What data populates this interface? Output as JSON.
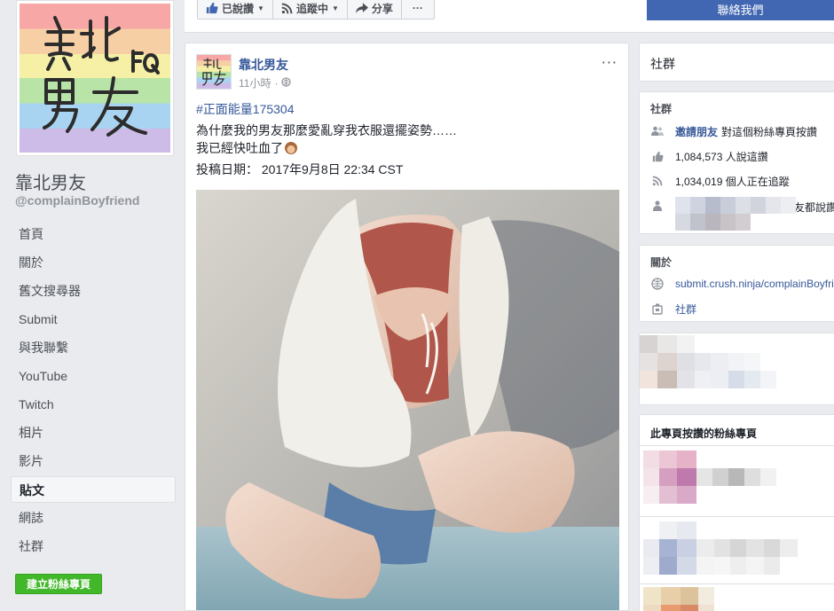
{
  "page": {
    "name": "靠北男友",
    "handle": "@complainBoyfriend",
    "create_page_label": "建立粉絲專頁"
  },
  "nav": [
    {
      "label": "首頁",
      "active": false
    },
    {
      "label": "關於",
      "active": false
    },
    {
      "label": "舊文搜尋器",
      "active": false
    },
    {
      "label": "Submit",
      "active": false
    },
    {
      "label": "與我聯繫",
      "active": false
    },
    {
      "label": "YouTube",
      "active": false
    },
    {
      "label": "Twitch",
      "active": false
    },
    {
      "label": "相片",
      "active": false
    },
    {
      "label": "影片",
      "active": false
    },
    {
      "label": "貼文",
      "active": true
    },
    {
      "label": "網誌",
      "active": false
    },
    {
      "label": "社群",
      "active": false
    }
  ],
  "topbar": {
    "liked_label": "已說讚",
    "following_label": "追蹤中",
    "share_label": "分享",
    "more_label": "···",
    "contact_label": "聯絡我們"
  },
  "post": {
    "author": "靠北男友",
    "time": "11小時",
    "separator": "·",
    "hashtag": "#正面能量175304",
    "line1": "為什麼我的男友那麼愛亂穿我衣服還擺姿勢……",
    "line2": "我已經快吐血了",
    "date_line": "投稿日期： 2017年9月8日 22:34 CST",
    "more_label": "···"
  },
  "right": {
    "community_header": "社群",
    "community": {
      "title": "社群",
      "invite_link": "邀請朋友",
      "invite_rest": "對這個粉絲專頁按讚",
      "likes": "1,084,573 人說這讚",
      "follows": "1,034,019 個人正在追蹤",
      "friends_suffix": "友都說讚"
    },
    "about": {
      "title": "關於",
      "url": "submit.crush.ninja/complainBoyfriend",
      "category": "社群"
    },
    "liked_pages_title": "此專頁按讚的粉絲專頁"
  },
  "icons": {
    "like": "thumbs-up-icon",
    "rss": "rss-icon",
    "share": "share-arrow-icon",
    "globe": "globe-icon",
    "people": "people-icon",
    "tag": "category-icon"
  },
  "colors": {
    "fb_blue": "#4267b2",
    "link": "#365899",
    "green": "#42b72a",
    "bg": "#e9ebee"
  }
}
